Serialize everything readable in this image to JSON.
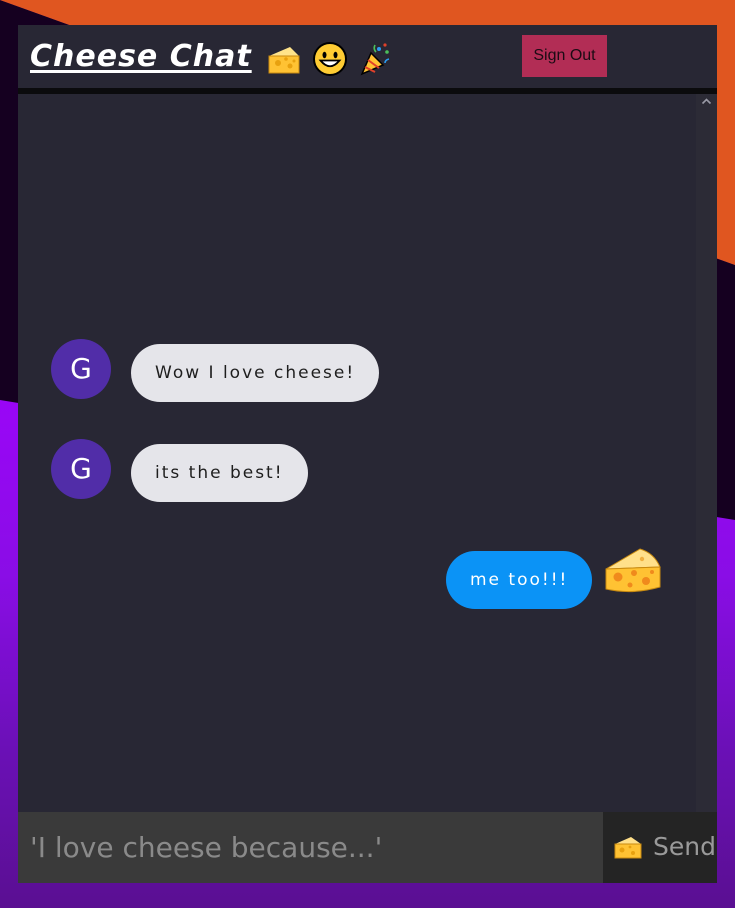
{
  "header": {
    "title": "Cheese Chat",
    "emojis": [
      "cheese-icon",
      "grinning-face-icon",
      "party-popper-icon"
    ],
    "sign_out_label": "Sign Out"
  },
  "messages": [
    {
      "type": "received",
      "avatar_initial": "G",
      "text": "Wow I love cheese!"
    },
    {
      "type": "received",
      "avatar_initial": "G",
      "text": "its the best!"
    },
    {
      "type": "sent",
      "avatar_icon": "cheese-icon",
      "text": "me too!!!"
    }
  ],
  "composer": {
    "placeholder": "'I love cheese because...'",
    "send_label": "Send",
    "send_icon": "cheese-icon"
  },
  "colors": {
    "received_bubble": "#e5e5ea",
    "sent_bubble": "#0b93f6",
    "avatar": "#512da8",
    "sign_out": "#b22d55",
    "panel": "#282734"
  }
}
